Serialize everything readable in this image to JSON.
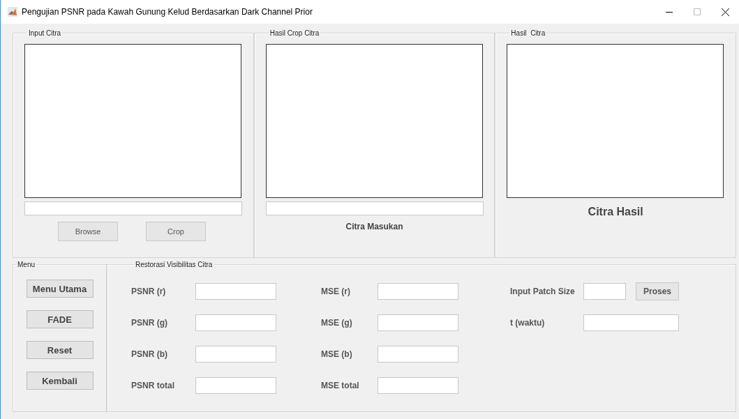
{
  "window": {
    "title": "Pengujian PSNR pada Kawah Gunung Kelud Berdasarkan Dark Channel Prior"
  },
  "input_citra": {
    "title": "Input Citra",
    "buttons": [
      "Browse",
      "Crop"
    ]
  },
  "hasil_crop": {
    "title": "Hasil Crop Citra",
    "caption": "Citra Masukan"
  },
  "hasil_citra": {
    "title": "Hasil  Citra",
    "caption": "Citra Hasil"
  },
  "menu": {
    "title": "Menu",
    "buttons": [
      "Menu Utama",
      "FADE",
      "Reset",
      "Kembali"
    ]
  },
  "restorasi": {
    "title": "Restorasi Visibilitas Citra",
    "psnr": [
      "PSNR (r)",
      "PSNR (g)",
      "PSNR (b)",
      "PSNR total"
    ],
    "mse": [
      "MSE (r)",
      "MSE (g)",
      "MSE (b)",
      "MSE total"
    ],
    "patch_size_label": "Input Patch Size",
    "process_button": "Proses",
    "time_label": "t (waktu)"
  }
}
